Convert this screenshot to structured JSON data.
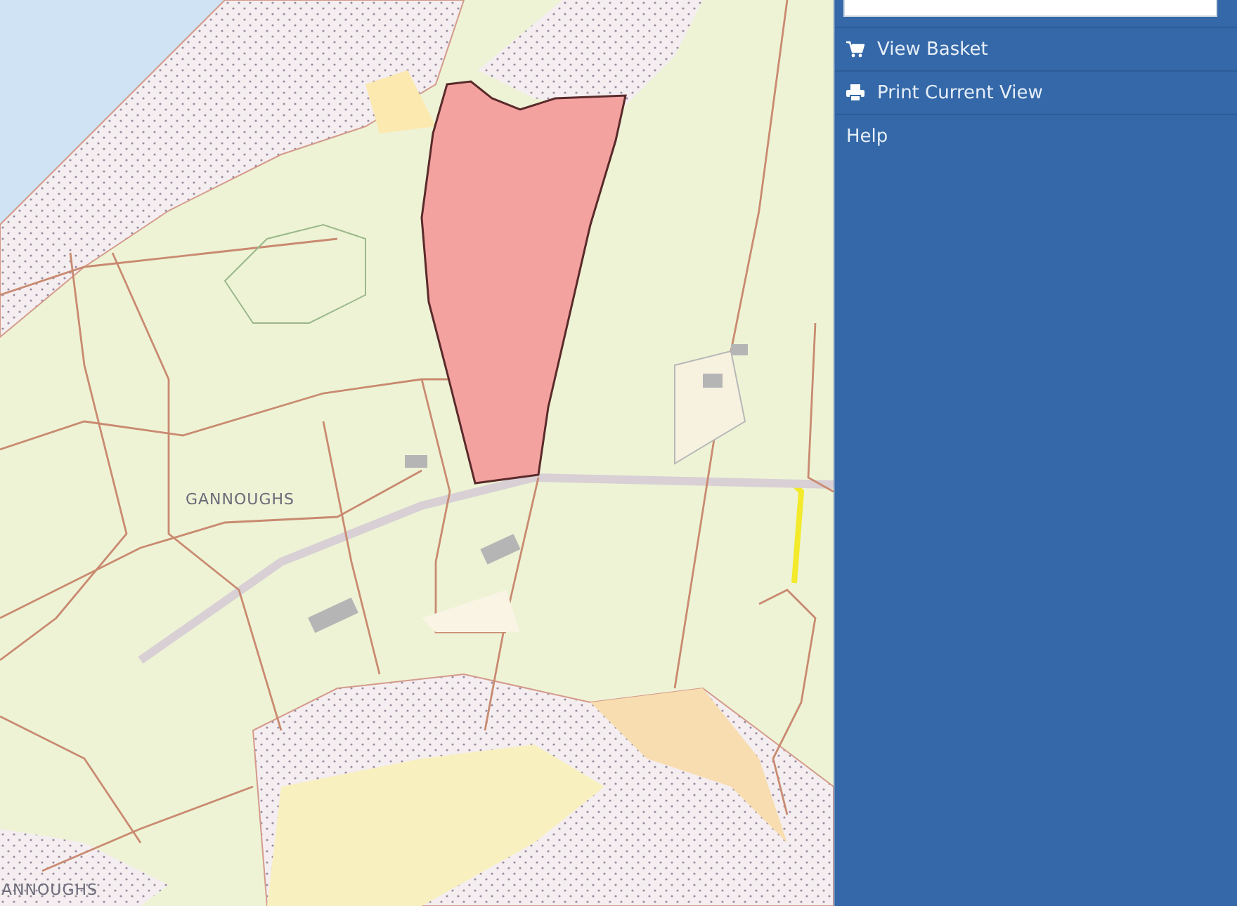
{
  "map": {
    "place_labels": [
      "GANNOUGHS",
      "ANNOUGHS"
    ]
  },
  "sidebar": {
    "menu": [
      {
        "kind": "basket",
        "label": "View Basket"
      },
      {
        "kind": "print",
        "label": "Print Current View"
      },
      {
        "kind": "plain",
        "label": "Help"
      }
    ]
  }
}
